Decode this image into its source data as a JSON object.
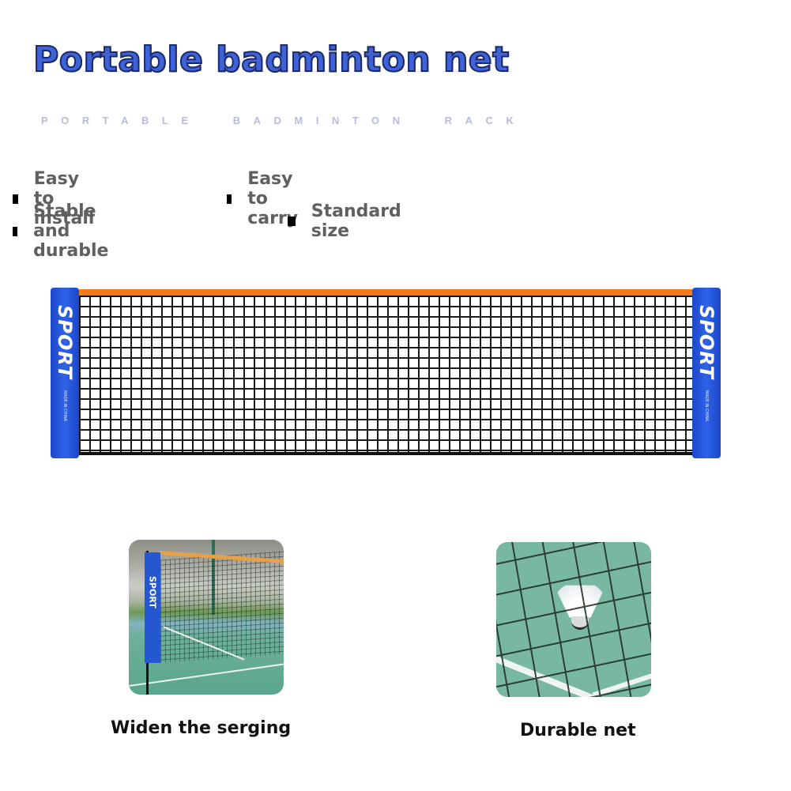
{
  "header": {
    "title": "Portable badminton net",
    "subtitle": "PORTABLE  BADMINTON  RACK"
  },
  "features": [
    {
      "label": "Easy to install",
      "icon": "square-bullet-icon"
    },
    {
      "label": "Easy to carry",
      "icon": "square-bullet-icon"
    },
    {
      "label": "Stable and durable",
      "icon": "square-bullet-icon"
    },
    {
      "label": "Standard size",
      "icon": "square-bullet-icon"
    }
  ],
  "product": {
    "pole_label": "SPORT",
    "pole_small_text": "MADE IN CHINA",
    "colors": {
      "top_band": "#f47a1c",
      "pole": "#2457d0",
      "mesh": "#1a1a1a",
      "title": "#3f62d6"
    }
  },
  "details": [
    {
      "caption": "Widen the serging",
      "image": "net-on-court-photo",
      "pole_label": "SPORT"
    },
    {
      "caption": "Durable net",
      "image": "shuttlecock-in-net-photo"
    }
  ]
}
